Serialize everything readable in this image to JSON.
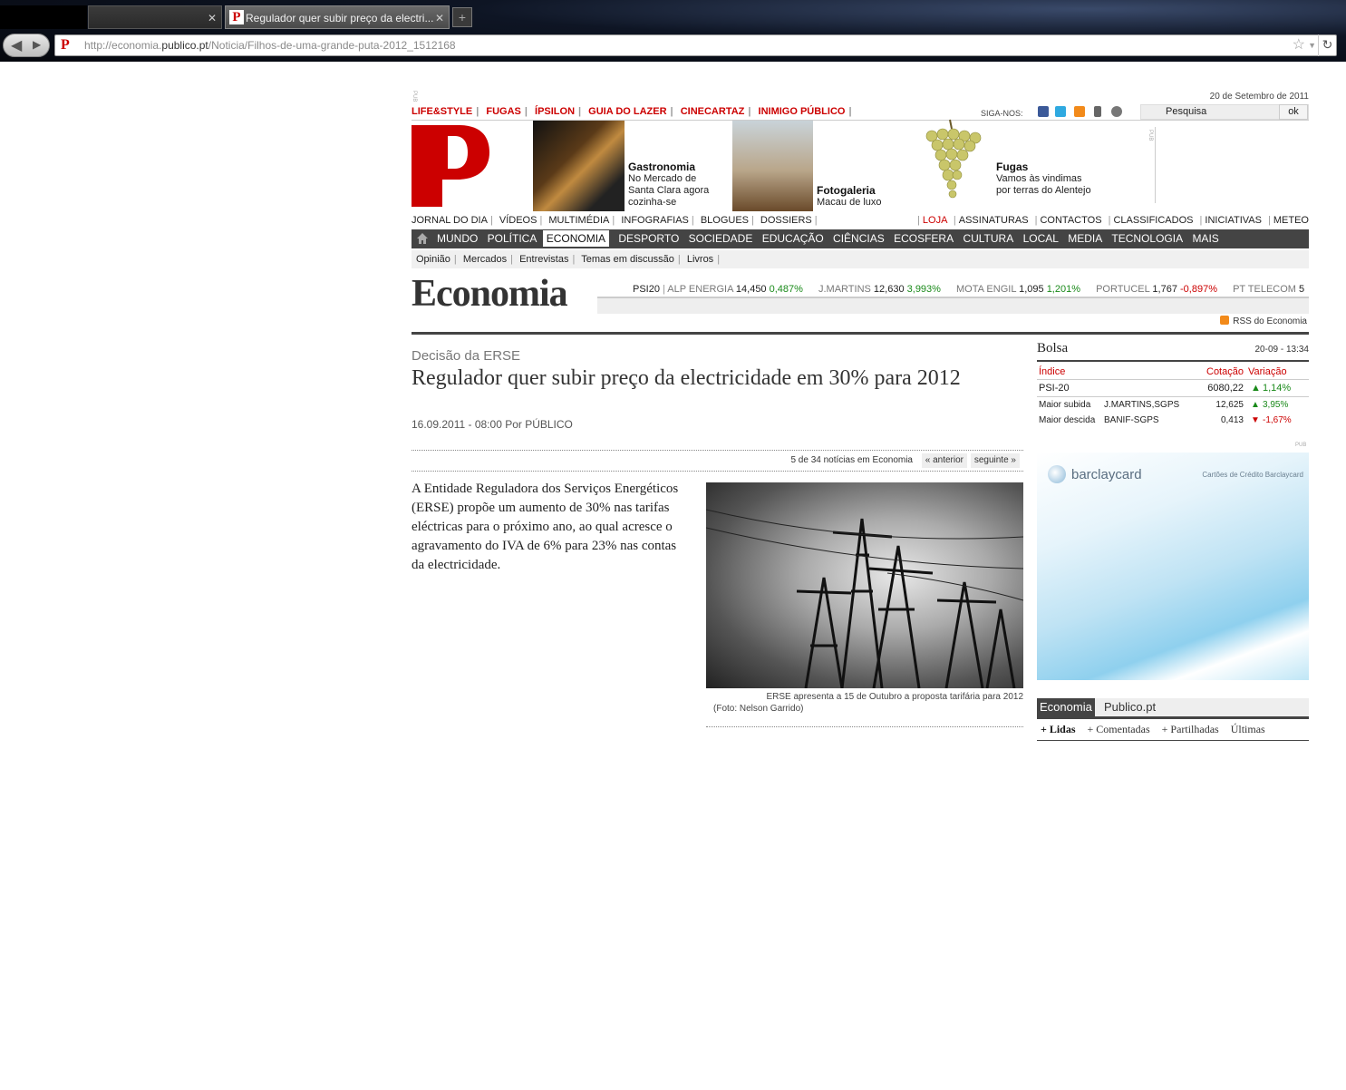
{
  "browser": {
    "tab2_title": "",
    "tab3_title": "Regulador quer subir preço da electri...",
    "url_prefix": "http://economia.",
    "url_domain": "publico.pt",
    "url_path": "/Noticia/Filhos-de-uma-grande-puta-2012_1512168"
  },
  "header": {
    "pub": "PUB",
    "date": "20 de Setembro de 2011",
    "top_links": [
      "LIFE&STYLE",
      "FUGAS",
      "ÍPSILON",
      "GUIA DO LAZER",
      "CINECARTAZ",
      "INIMIGO PÚBLICO"
    ],
    "siga": "SIGA-NOS:",
    "search_label": "Pesquisa",
    "search_button": "ok"
  },
  "promos": [
    {
      "title": "Gastronomia",
      "text": "No Mercado de Santa Clara agora cozinha-se"
    },
    {
      "title": "Fotogaleria",
      "text": "Macau de luxo"
    },
    {
      "title": "Fugas",
      "text": "Vamos às vindimas por terras do Alentejo"
    }
  ],
  "nav1_left": [
    "JORNAL DO DIA",
    "VÍDEOS",
    "MULTIMÉDIA",
    "INFOGRAFIAS",
    "BLOGUES",
    "DOSSIERS"
  ],
  "nav1_right": [
    "LOJA",
    "ASSINATURAS",
    "CONTACTOS",
    "CLASSIFICADOS",
    "INICIATIVAS",
    "METEO"
  ],
  "nav2": [
    "MUNDO",
    "POLÍTICA",
    "ECONOMIA",
    "DESPORTO",
    "SOCIEDADE",
    "EDUCAÇÃO",
    "CIÊNCIAS",
    "ECOSFERA",
    "CULTURA",
    "LOCAL",
    "MEDIA",
    "TECNOLOGIA",
    "MAIS"
  ],
  "nav3": [
    "Opinião",
    "Mercados",
    "Entrevistas",
    "Temas em discussão",
    "Livros"
  ],
  "section_title": "Economia",
  "ticker": {
    "index": "PSI20",
    "items": [
      {
        "name": "ALP ENERGIA",
        "price": "14,450",
        "change": "0,487%",
        "dir": "up"
      },
      {
        "name": "J.MARTINS",
        "price": "12,630",
        "change": "3,993%",
        "dir": "up"
      },
      {
        "name": "MOTA ENGIL",
        "price": "1,095",
        "change": "1,201%",
        "dir": "up"
      },
      {
        "name": "PORTUCEL",
        "price": "1,767",
        "change": "-0,897%",
        "dir": "down"
      },
      {
        "name": "PT TELECOM",
        "price": "5",
        "change": "",
        "dir": "none"
      }
    ]
  },
  "rss": "RSS do Economia",
  "article": {
    "kicker": "Decisão da ERSE",
    "headline": "Regulador quer subir preço da electricidade em 30% para 2012",
    "byline": "16.09.2011 - 08:00 Por PÚBLICO",
    "pager_count": "5 de 34 notícias em Economia",
    "prev": "« anterior",
    "next": "seguinte »",
    "lead": "A Entidade Reguladora dos Serviços Energéticos (ERSE) propõe um aumento de 30% nas tarifas eléctricas para o próximo ano, ao qual acresce o agravamento do IVA de 6% para 23% nas contas da electricidade.",
    "caption": "ERSE apresenta a 15 de Outubro a proposta tarifária para 2012",
    "credit": "(Foto: Nelson Garrido)"
  },
  "bolsa": {
    "title": "Bolsa",
    "time": "20-09 - 13:34",
    "col_index": "Índice",
    "col_price": "Cotação",
    "col_change": "Variação",
    "psi_name": "PSI-20",
    "psi_price": "6080,22",
    "psi_change": "1,14%",
    "up_label": "Maior subida",
    "up_name": "J.MARTINS,SGPS",
    "up_price": "12,625",
    "up_change": "3,95%",
    "down_label": "Maior descida",
    "down_name": "BANIF-SGPS",
    "down_price": "0,413",
    "down_change": "-1,67%"
  },
  "ad": {
    "pub": "PUB",
    "brand": "barclaycard",
    "sub": "Cartões de Crédito Barclaycard"
  },
  "tabs": {
    "active": "Economia",
    "other": "Publico.pt",
    "sub": [
      "+ Lidas",
      "+ Comentadas",
      "+ Partilhadas",
      "Últimas"
    ]
  },
  "colors": {
    "accent": "#cc0000",
    "bar": "#444444",
    "up": "#1a8a1a",
    "down": "#cc0000"
  }
}
